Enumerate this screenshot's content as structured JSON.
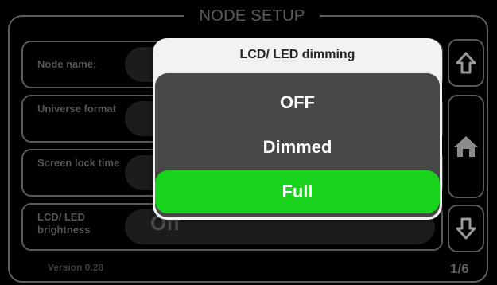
{
  "window": {
    "title": "NODE SETUP"
  },
  "rows": [
    {
      "label": "Node name:",
      "value": ""
    },
    {
      "label": "Universe format",
      "value": ""
    },
    {
      "label": "Screen lock time",
      "value": ""
    },
    {
      "label": "LCD/ LED brightness",
      "value": "Off"
    }
  ],
  "version": "Version 0.28",
  "page_indicator": "1/6",
  "nav": {
    "up_icon": "arrow-up-icon",
    "home_icon": "home-icon",
    "down_icon": "arrow-down-icon"
  },
  "dialog": {
    "title": "LCD/ LED dimming",
    "options": [
      "OFF",
      "Dimmed",
      "Full"
    ],
    "selected": "Full"
  },
  "colors": {
    "selected": "#19d21c",
    "dialog_body": "#474747",
    "frame": "#5e5e5e"
  }
}
